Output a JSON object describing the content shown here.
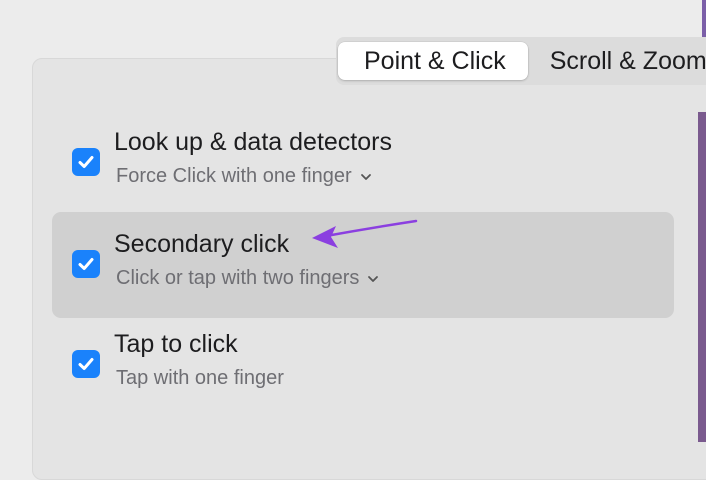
{
  "tabs": [
    {
      "label": "Point & Click",
      "selected": true
    },
    {
      "label": "Scroll & Zoom",
      "selected": false
    }
  ],
  "rows": [
    {
      "title": "Look up & data detectors",
      "subtitle": "Force Click with one finger",
      "checked": true,
      "has_dropdown": true
    },
    {
      "title": "Secondary click",
      "subtitle": "Click or tap with two fingers",
      "checked": true,
      "has_dropdown": true,
      "highlighted": true
    },
    {
      "title": "Tap to click",
      "subtitle": "Tap with one finger",
      "checked": true,
      "has_dropdown": false
    }
  ],
  "colors": {
    "checkbox": "#1a82fb",
    "annotation_arrow": "#8b3fe0"
  },
  "icons": {
    "checkmark": "checkmark-icon",
    "dropdown": "chevron-down-icon",
    "annotation": "annotation-arrow-icon"
  }
}
